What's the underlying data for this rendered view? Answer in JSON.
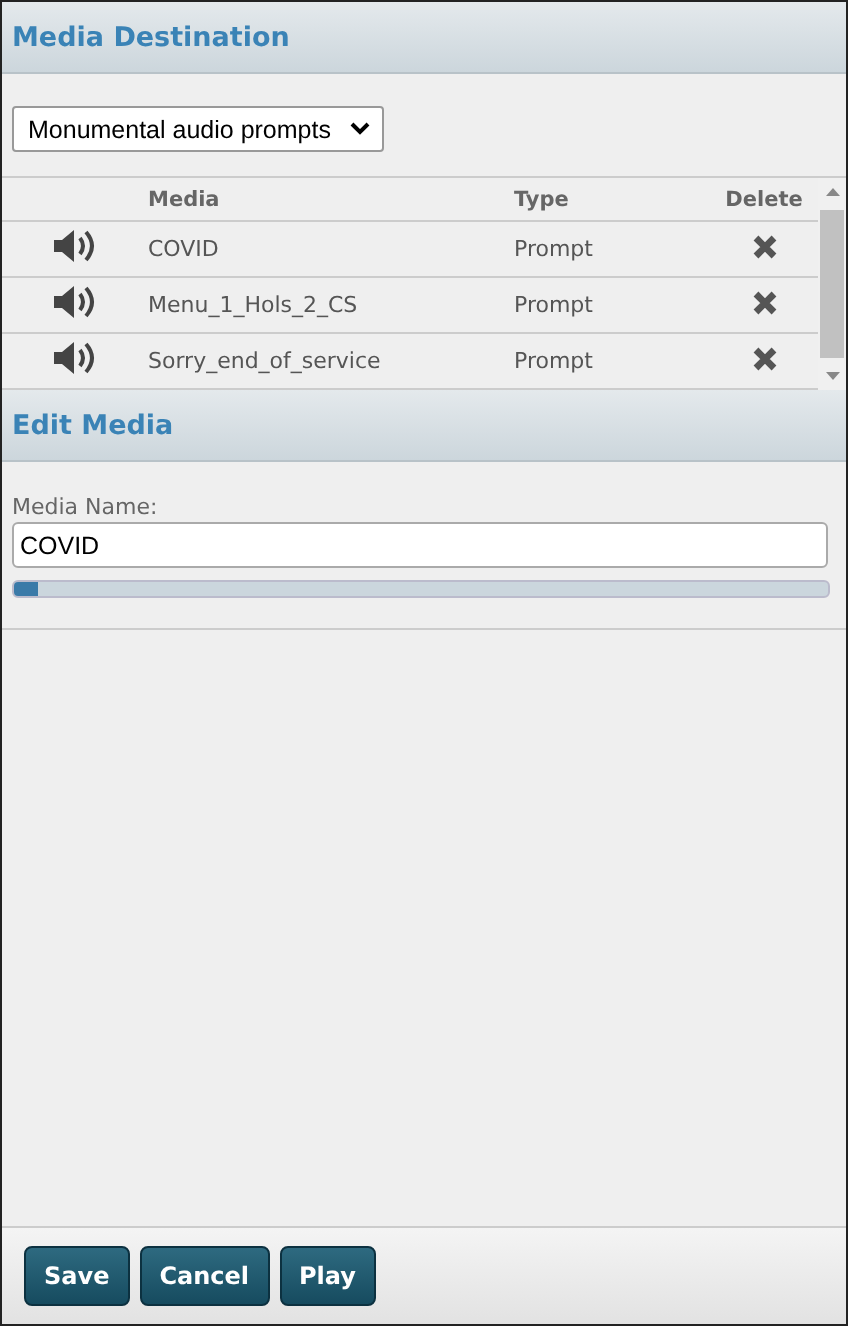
{
  "media_destination": {
    "title": "Media Destination",
    "dropdown": {
      "value": "Monumental audio prompts"
    },
    "table": {
      "columns": [
        "Media",
        "Type",
        "Delete"
      ],
      "rows": [
        {
          "media": "COVID",
          "type": "Prompt"
        },
        {
          "media": "Menu_1_Hols_2_CS",
          "type": "Prompt"
        },
        {
          "media": "Sorry_end_of_service",
          "type": "Prompt"
        }
      ]
    }
  },
  "edit_media": {
    "title": "Edit Media",
    "media_name": {
      "label": "Media Name:",
      "value": "COVID"
    },
    "progress": {
      "level": 0.03
    }
  },
  "buttons": [
    "Save",
    "Cancel",
    "Play"
  ]
}
